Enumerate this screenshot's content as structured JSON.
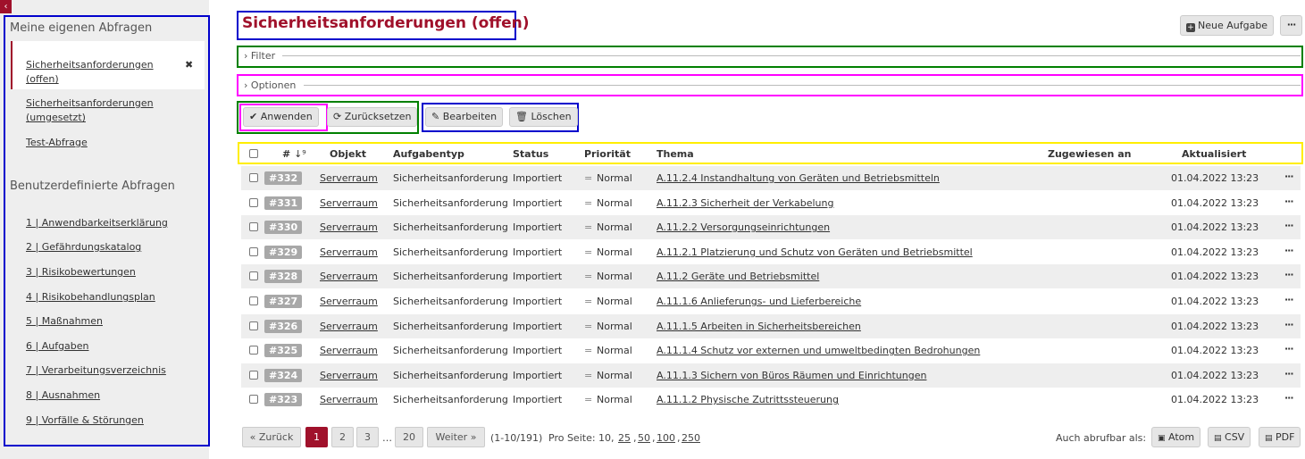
{
  "sidebar": {
    "collapse_icon": "‹",
    "my_queries_heading": "Meine eigenen Abfragen",
    "my_queries": [
      "Sicherheitsanforderungen (offen)",
      "Sicherheitsanforderungen (umgesetzt)",
      "Test-Abfrage"
    ],
    "custom_heading": "Benutzerdefinierte Abfragen",
    "custom_queries": [
      "1 | Anwendbarkeitserklärung",
      "2 | Gefährdungskatalog",
      "3 | Risikobewertungen",
      "4 | Risikobehandlungsplan",
      "5 | Maßnahmen",
      "6 | Aufgaben",
      "7 | Verarbeitungsverzeichnis",
      "8 | Ausnahmen",
      "9 | Vorfälle & Störungen"
    ]
  },
  "header": {
    "title": "Sicherheitsanforderungen (offen)",
    "new_task": "Neue Aufgabe",
    "more": "···"
  },
  "filter_label": "Filter",
  "options_label": "Optionen",
  "actions": {
    "apply": "Anwenden",
    "reset": "Zurücksetzen",
    "edit": "Bearbeiten",
    "delete": "Löschen"
  },
  "table": {
    "columns": [
      "#",
      "Objekt",
      "Aufgabentyp",
      "Status",
      "Priorität",
      "Thema",
      "Zugewiesen an",
      "Aktualisiert"
    ],
    "rows": [
      {
        "id": "#332",
        "objekt": "Serverraum",
        "typ": "Sicherheitsanforderung",
        "status": "Importiert",
        "prio": "Normal",
        "thema": "A.11.2.4 Instandhaltung von Geräten und Betriebsmitteln",
        "date": "01.04.2022 13:23"
      },
      {
        "id": "#331",
        "objekt": "Serverraum",
        "typ": "Sicherheitsanforderung",
        "status": "Importiert",
        "prio": "Normal",
        "thema": "A.11.2.3 Sicherheit der Verkabelung",
        "date": "01.04.2022 13:23"
      },
      {
        "id": "#330",
        "objekt": "Serverraum",
        "typ": "Sicherheitsanforderung",
        "status": "Importiert",
        "prio": "Normal",
        "thema": "A.11.2.2 Versorgungseinrichtungen",
        "date": "01.04.2022 13:23"
      },
      {
        "id": "#329",
        "objekt": "Serverraum",
        "typ": "Sicherheitsanforderung",
        "status": "Importiert",
        "prio": "Normal",
        "thema": "A.11.2.1 Platzierung und Schutz von Geräten und Betriebsmittel",
        "date": "01.04.2022 13:23"
      },
      {
        "id": "#328",
        "objekt": "Serverraum",
        "typ": "Sicherheitsanforderung",
        "status": "Importiert",
        "prio": "Normal",
        "thema": "A.11.2 Geräte und Betriebsmittel",
        "date": "01.04.2022 13:23"
      },
      {
        "id": "#327",
        "objekt": "Serverraum",
        "typ": "Sicherheitsanforderung",
        "status": "Importiert",
        "prio": "Normal",
        "thema": "A.11.1.6 Anlieferungs- und Lieferbereiche",
        "date": "01.04.2022 13:23"
      },
      {
        "id": "#326",
        "objekt": "Serverraum",
        "typ": "Sicherheitsanforderung",
        "status": "Importiert",
        "prio": "Normal",
        "thema": "A.11.1.5 Arbeiten in Sicherheitsbereichen",
        "date": "01.04.2022 13:23"
      },
      {
        "id": "#325",
        "objekt": "Serverraum",
        "typ": "Sicherheitsanforderung",
        "status": "Importiert",
        "prio": "Normal",
        "thema": "A.11.1.4 Schutz vor externen und umweltbedingten Bedrohungen",
        "date": "01.04.2022 13:23"
      },
      {
        "id": "#324",
        "objekt": "Serverraum",
        "typ": "Sicherheitsanforderung",
        "status": "Importiert",
        "prio": "Normal",
        "thema": "A.11.1.3 Sichern von Büros Räumen und Einrichtungen",
        "date": "01.04.2022 13:23"
      },
      {
        "id": "#323",
        "objekt": "Serverraum",
        "typ": "Sicherheitsanforderung",
        "status": "Importiert",
        "prio": "Normal",
        "thema": "A.11.1.2 Physische Zutrittssteuerung",
        "date": "01.04.2022 13:23"
      }
    ],
    "row_menu": "···"
  },
  "pagination": {
    "prev": "« Zurück",
    "pages": [
      "1",
      "2",
      "3"
    ],
    "ellipsis": "…",
    "last": "20",
    "next": "Weiter »",
    "range": "(1-10/191)",
    "per_page_label": "Pro Seite: 10,",
    "per_page_options": [
      "25",
      "50",
      "100",
      "250"
    ]
  },
  "export": {
    "label": "Auch abrufbar als:",
    "atom": "Atom",
    "csv": "CSV",
    "pdf": "PDF"
  },
  "colors": {
    "brand": "#a0112b",
    "box_blue": "#0000cc",
    "box_green": "#008000",
    "box_magenta": "#ff00ff",
    "box_yellow": "#ffee00"
  }
}
